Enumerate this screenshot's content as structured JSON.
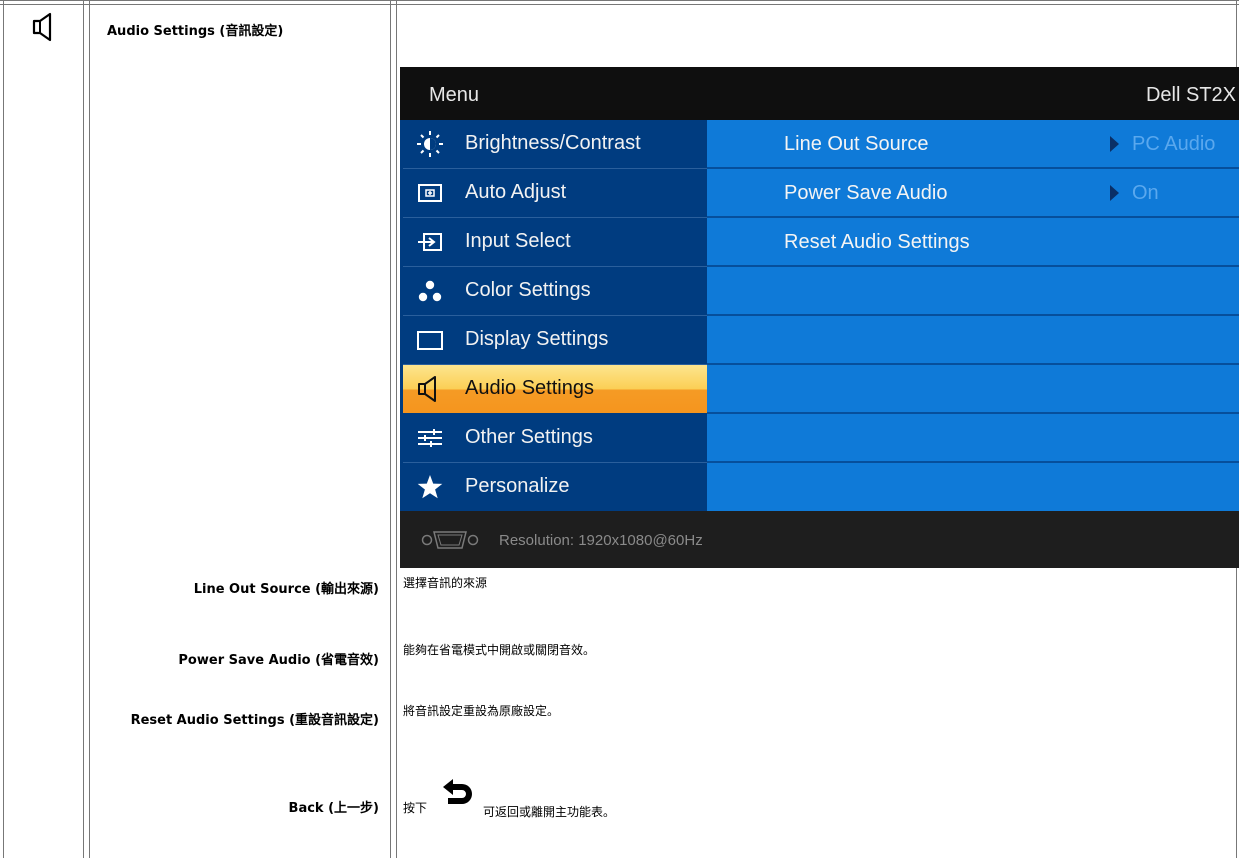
{
  "heading": "Audio Settings (音訊設定)",
  "osd": {
    "menu_title": "Menu",
    "model": "Dell ST2X",
    "items": [
      {
        "label": "Brightness/Contrast",
        "icon": "brightness-icon"
      },
      {
        "label": "Auto Adjust",
        "icon": "auto-adjust-icon"
      },
      {
        "label": "Input Select",
        "icon": "input-select-icon"
      },
      {
        "label": "Color Settings",
        "icon": "color-settings-icon"
      },
      {
        "label": "Display Settings",
        "icon": "display-settings-icon"
      },
      {
        "label": "Audio Settings",
        "icon": "speaker-icon",
        "active": true
      },
      {
        "label": "Other Settings",
        "icon": "other-settings-icon"
      },
      {
        "label": "Personalize",
        "icon": "star-icon"
      }
    ],
    "rows": [
      {
        "label": "Line Out Source",
        "value": "PC Audio"
      },
      {
        "label": "Power Save Audio",
        "value": "On"
      },
      {
        "label": "Reset Audio Settings",
        "value": ""
      }
    ],
    "footer": "Resolution: 1920x1080@60Hz",
    "colors": {
      "left_panel": "#003c80",
      "right_panel": "#0f7ad8",
      "active_item": "#f5951e"
    }
  },
  "settings": [
    {
      "label": "Line Out Source (輸出來源)",
      "desc": "選擇音訊的來源"
    },
    {
      "label": "Power Save Audio (省電音效)",
      "desc": "能夠在省電模式中開啟或關閉音效。"
    },
    {
      "label": "Reset Audio Settings (重設音訊設定)",
      "desc": "將音訊設定重設為原廠設定。"
    },
    {
      "label": "Back (上一步)",
      "desc_before": "按下",
      "desc_after": "可返回或離開主功能表。"
    }
  ]
}
